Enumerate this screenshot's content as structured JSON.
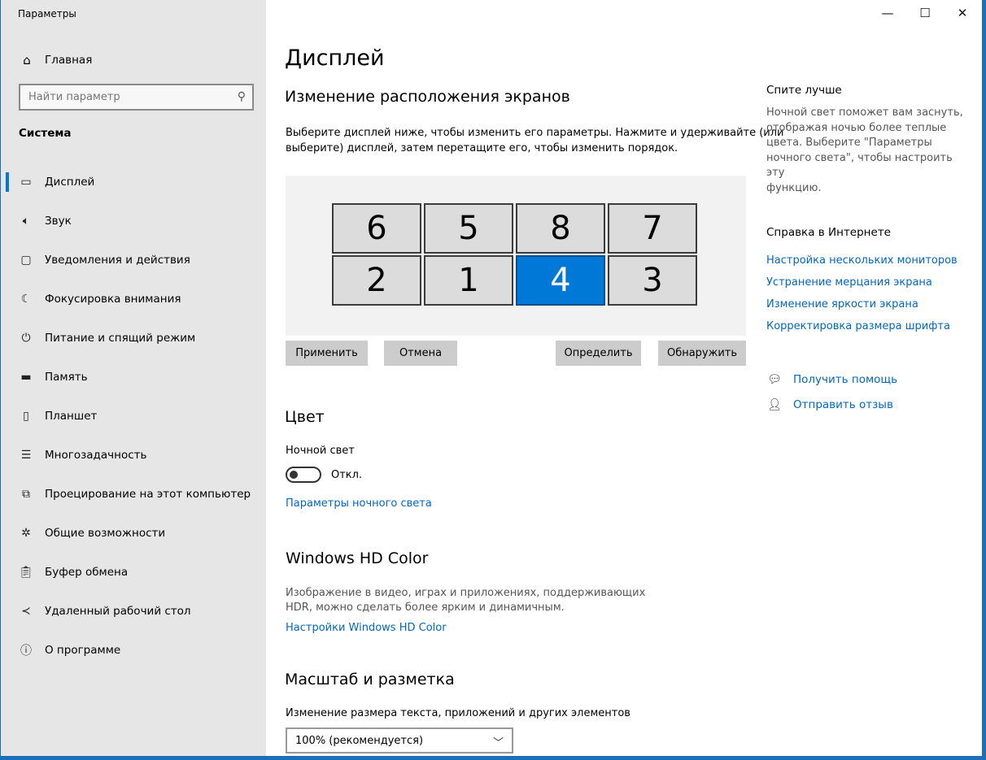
{
  "window": {
    "title": "Параметры",
    "controls": {
      "minimize": "—",
      "maximize": "☐",
      "close": "✕"
    }
  },
  "sidebar": {
    "home_label": "Главная",
    "search_placeholder": "Найти параметр",
    "section": "Система",
    "items": [
      {
        "label": "Дисплей",
        "icon": "monitor-icon",
        "glyph": "▭",
        "active": true
      },
      {
        "label": "Звук",
        "icon": "speaker-icon",
        "glyph": "🔈︎"
      },
      {
        "label": "Уведомления и действия",
        "icon": "notification-icon",
        "glyph": "▢"
      },
      {
        "label": "Фокусировка внимания",
        "icon": "moon-icon",
        "glyph": "☾"
      },
      {
        "label": "Питание и спящий режим",
        "icon": "power-icon",
        "glyph": "⏻"
      },
      {
        "label": "Память",
        "icon": "storage-icon",
        "glyph": "▬"
      },
      {
        "label": "Планшет",
        "icon": "tablet-icon",
        "glyph": "▯"
      },
      {
        "label": "Многозадачность",
        "icon": "multitasking-icon",
        "glyph": "☰"
      },
      {
        "label": "Проецирование на этот компьютер",
        "icon": "projecting-icon",
        "glyph": "⧉"
      },
      {
        "label": "Общие возможности",
        "icon": "shared-experiences-icon",
        "glyph": "✲"
      },
      {
        "label": "Буфер обмена",
        "icon": "clipboard-icon",
        "glyph": "📋︎"
      },
      {
        "label": "Удаленный рабочий стол",
        "icon": "remote-desktop-icon",
        "glyph": "≺"
      },
      {
        "label": "О программе",
        "icon": "info-icon",
        "glyph": "ⓘ"
      }
    ]
  },
  "main": {
    "title": "Дисплей",
    "arrangement": {
      "heading": "Изменение расположения экранов",
      "description_line1": "Выберите дисплей ниже, чтобы изменить его параметры. Нажмите и удерживайте (или",
      "description_line2": "выберите) дисплей, затем перетащите его, чтобы изменить порядок.",
      "monitors": [
        {
          "label": "6",
          "row": 0,
          "col": 0
        },
        {
          "label": "5",
          "row": 0,
          "col": 1
        },
        {
          "label": "8",
          "row": 0,
          "col": 2
        },
        {
          "label": "7",
          "row": 0,
          "col": 3
        },
        {
          "label": "2",
          "row": 1,
          "col": 0
        },
        {
          "label": "1",
          "row": 1,
          "col": 1
        },
        {
          "label": "4",
          "row": 1,
          "col": 2,
          "selected": true
        },
        {
          "label": "3",
          "row": 1,
          "col": 3
        }
      ],
      "buttons": {
        "apply": "Применить",
        "cancel": "Отмена",
        "identify": "Определить",
        "detect": "Обнаружить"
      }
    },
    "color": {
      "heading": "Цвет",
      "night_light_label": "Ночной свет",
      "toggle_state": "Откл.",
      "night_light_settings_link": "Параметры ночного света"
    },
    "hdr": {
      "heading": "Windows HD Color",
      "desc_line1": "Изображение в видео, играх и приложениях, поддерживающих",
      "desc_line2": "HDR, можно сделать более ярким и динамичным.",
      "link": "Настройки Windows HD Color"
    },
    "scale": {
      "heading": "Масштаб и разметка",
      "label": "Изменение размера текста, приложений и других элементов",
      "selected": "100% (рекомендуется)"
    }
  },
  "right": {
    "sleep_heading": "Спите лучше",
    "sleep_text": [
      "Ночной свет поможет вам заснуть,",
      "отображая ночью более теплые",
      "цвета. Выберите \"Параметры",
      "ночного света\", чтобы настроить эту",
      "функцию."
    ],
    "web_help_heading": "Справка в Интернете",
    "links": [
      "Настройка нескольких мониторов",
      "Устранение мерцания экрана",
      "Изменение яркости экрана",
      "Корректировка размера шрифта"
    ],
    "get_help": "Получить помощь",
    "feedback": "Отправить отзыв"
  },
  "colors": {
    "accent": "#0078d7",
    "link": "#0067c0",
    "sidebar_bg": "#e6e6e6"
  }
}
